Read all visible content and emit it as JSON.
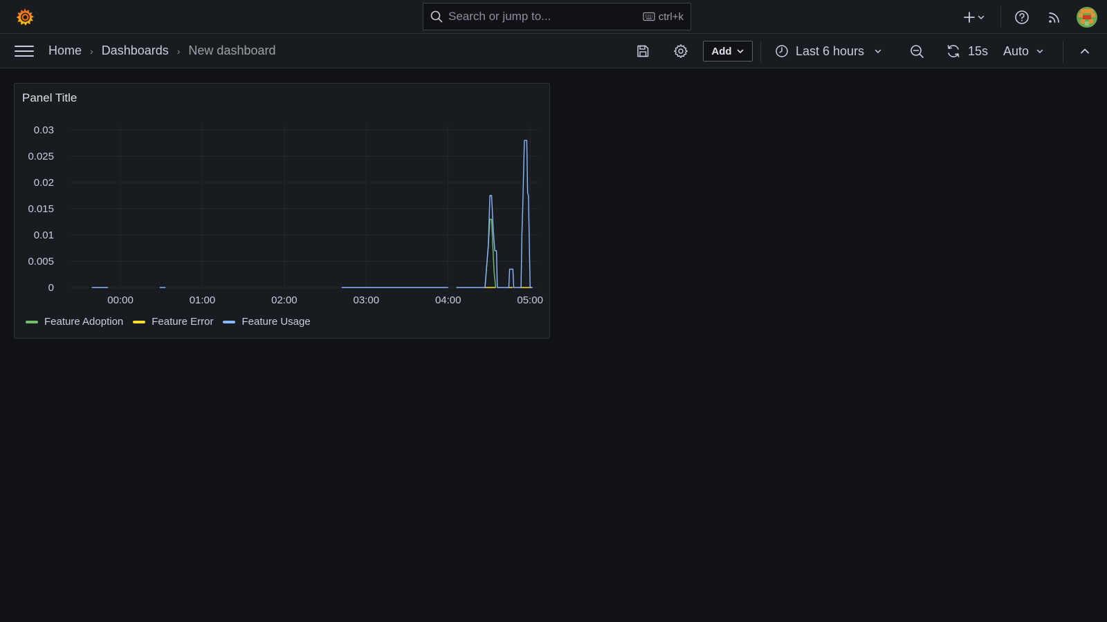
{
  "topbar": {
    "search_placeholder": "Search or jump to...",
    "search_shortcut": "ctrl+k"
  },
  "navbar": {
    "breadcrumbs": [
      "Home",
      "Dashboards",
      "New dashboard"
    ],
    "add_label": "Add",
    "time_range": "Last 6 hours",
    "refresh_interval": "15s",
    "refresh_mode": "Auto"
  },
  "colors": {
    "brand": "#f46800",
    "feature_adoption": "#73bf69",
    "feature_error": "#fade2a",
    "feature_usage": "#8ab8ff"
  },
  "panel": {
    "title": "Panel Title"
  },
  "chart_data": {
    "type": "line",
    "title": "Panel Title",
    "x_ticks": [
      "00:00",
      "01:00",
      "02:00",
      "03:00",
      "04:00",
      "05:00"
    ],
    "y_ticks": [
      "0",
      "0.005",
      "0.01",
      "0.015",
      "0.02",
      "0.025",
      "0.03"
    ],
    "ylim": [
      0,
      0.03
    ],
    "x_range_hours": [
      -0.6,
      5.1
    ],
    "grid": true,
    "legend_position": "bottom-left",
    "series": [
      {
        "name": "Feature Adoption",
        "color": "#73bf69",
        "points": [
          [
            4.45,
            0
          ],
          [
            4.49,
            0.008
          ],
          [
            4.51,
            0.013
          ],
          [
            4.53,
            0.013
          ],
          [
            4.56,
            0.003
          ],
          [
            4.58,
            0
          ]
        ]
      },
      {
        "name": "Feature Error",
        "color": "#fade2a",
        "points": [
          [
            4.45,
            0
          ],
          [
            4.58,
            0
          ],
          null,
          [
            4.73,
            0
          ],
          [
            4.79,
            0
          ],
          null,
          [
            4.87,
            0
          ],
          [
            5.02,
            0
          ]
        ]
      },
      {
        "name": "Feature Usage",
        "color": "#8ab8ff",
        "points": [
          [
            -0.35,
            0
          ],
          [
            -0.15,
            0
          ],
          null,
          [
            0.48,
            0
          ],
          [
            0.55,
            0
          ],
          null,
          [
            2.7,
            0
          ],
          [
            4.0,
            0
          ],
          null,
          [
            4.1,
            0
          ],
          [
            4.45,
            0
          ],
          [
            4.49,
            0.008
          ],
          [
            4.51,
            0.0175
          ],
          [
            4.53,
            0.0175
          ],
          [
            4.55,
            0.011
          ],
          [
            4.57,
            0.007
          ],
          [
            4.59,
            0.007
          ],
          [
            4.6,
            0
          ],
          [
            4.74,
            0
          ],
          [
            4.75,
            0.0035
          ],
          [
            4.79,
            0.0035
          ],
          [
            4.8,
            0
          ],
          [
            4.89,
            0
          ],
          [
            4.9,
            0.01
          ],
          [
            4.91,
            0.015
          ],
          [
            4.93,
            0.028
          ],
          [
            4.96,
            0.028
          ],
          [
            4.97,
            0.018
          ],
          [
            4.98,
            0.0175
          ],
          [
            5.0,
            0
          ],
          [
            5.03,
            0
          ]
        ]
      }
    ]
  }
}
